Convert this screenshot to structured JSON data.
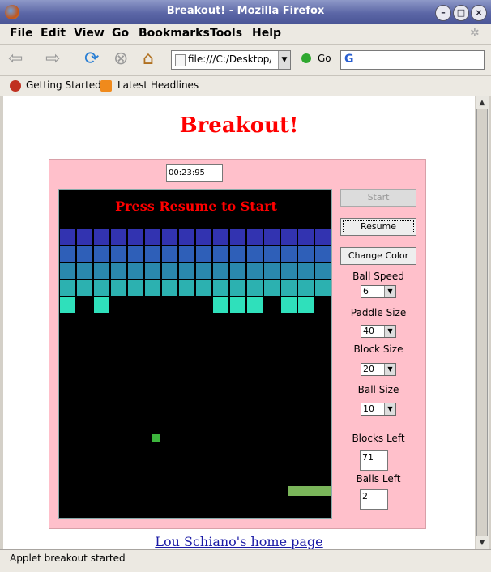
{
  "window": {
    "title": "Breakout! - Mozilla Firefox"
  },
  "menu": [
    "File",
    "Edit",
    "View",
    "Go",
    "Bookmarks",
    "Tools",
    "Help"
  ],
  "toolbar": {
    "url": "file:///C:/Desktop/",
    "go_label": "Go"
  },
  "bookmarks": [
    "Getting Started",
    "Latest Headlines"
  ],
  "page": {
    "title": "Breakout!",
    "home_link": "Lou Schiano's home page"
  },
  "applet": {
    "timer": "00:23:95",
    "message": "Press Resume to Start",
    "buttons": {
      "start": "Start",
      "resume": "Resume",
      "change_color": "Change Color"
    },
    "controls": {
      "ball_speed": {
        "label": "Ball Speed",
        "value": "6"
      },
      "paddle_size": {
        "label": "Paddle Size",
        "value": "40"
      },
      "block_size": {
        "label": "Block Size",
        "value": "20"
      },
      "ball_size": {
        "label": "Ball Size",
        "value": "10"
      }
    },
    "stats": {
      "blocks_left": {
        "label": "Blocks Left",
        "value": "71"
      },
      "balls_left": {
        "label": "Balls Left",
        "value": "2"
      }
    },
    "brick_colors": [
      "#3233b0",
      "#2e5fb8",
      "#2a88ad",
      "#2cb1b0",
      "#2fe0bb"
    ],
    "last_row_present": [
      0,
      2,
      9,
      10,
      11,
      13,
      14
    ]
  },
  "status": {
    "text": "Applet breakout started"
  }
}
